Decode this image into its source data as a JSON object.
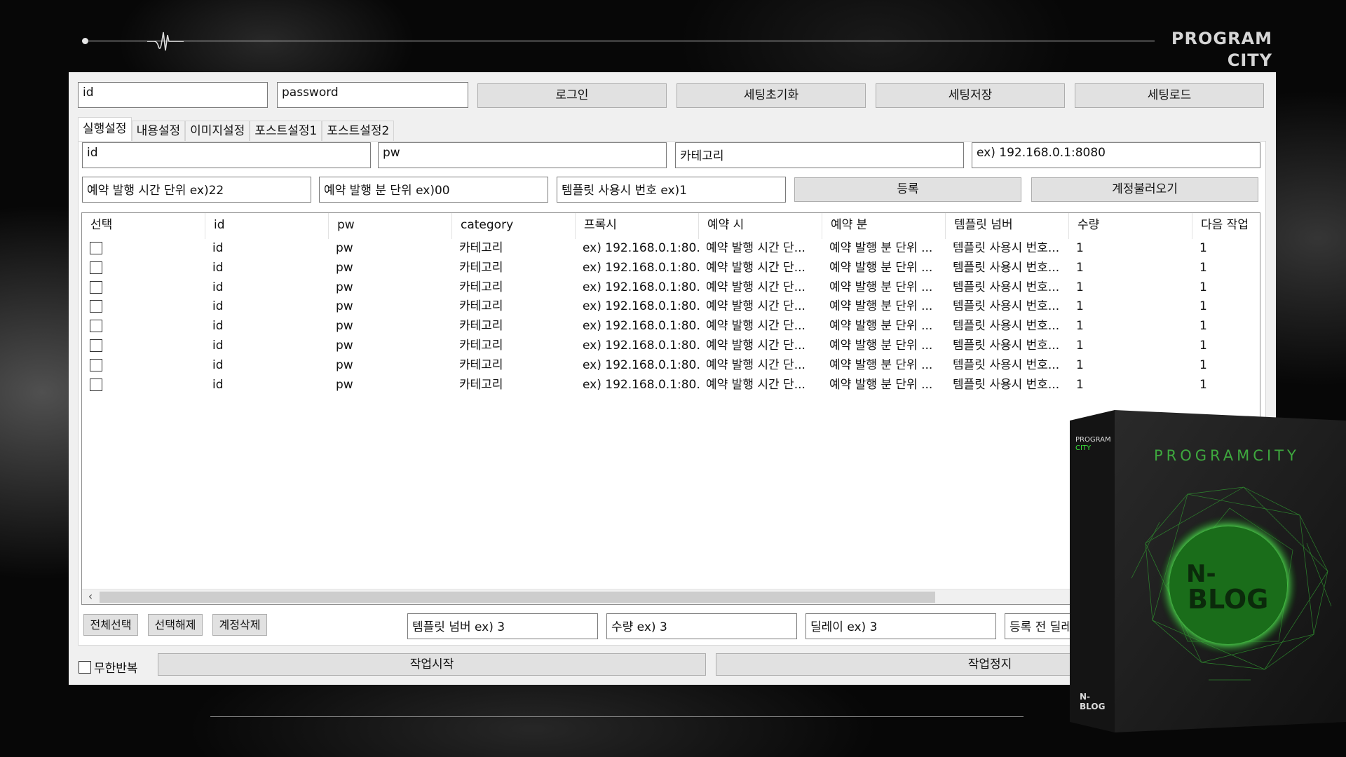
{
  "brand": {
    "line1": "PROGRAM",
    "line2": "CITY"
  },
  "login": {
    "id_placeholder": "id",
    "password_placeholder": "password",
    "login_label": "로그인",
    "reset_label": "세팅초기화",
    "save_label": "세팅저장",
    "load_label": "세팅로드"
  },
  "tabs": [
    "실행설정",
    "내용설정",
    "이미지설정",
    "포스트설정1",
    "포스트설정2"
  ],
  "form": {
    "id": "id",
    "pw": "pw",
    "category": "카테고리",
    "proxy": "ex) 192.168.0.1:8080",
    "hour": "예약 발행 시간 단위 ex)22",
    "minute": "예약 발행 분 단위 ex)00",
    "template": "템플릿 사용시 번호 ex)1",
    "register_label": "등록",
    "load_accounts_label": "계정불러오기"
  },
  "grid": {
    "headers": [
      "선택",
      "id",
      "pw",
      "category",
      "프록시",
      "예약 시",
      "예약 분",
      "템플릿 넘버",
      "수량",
      "다음 작업 "
    ],
    "rows": [
      [
        "id",
        "pw",
        "카테고리",
        "ex) 192.168.0.1:80...",
        "예약 발행 시간 단...",
        "예약 발행 분 단위 ...",
        "템플릿 사용시 번호...",
        "1",
        "1"
      ],
      [
        "id",
        "pw",
        "카테고리",
        "ex) 192.168.0.1:80...",
        "예약 발행 시간 단...",
        "예약 발행 분 단위 ...",
        "템플릿 사용시 번호...",
        "1",
        "1"
      ],
      [
        "id",
        "pw",
        "카테고리",
        "ex) 192.168.0.1:80...",
        "예약 발행 시간 단...",
        "예약 발행 분 단위 ...",
        "템플릿 사용시 번호...",
        "1",
        "1"
      ],
      [
        "id",
        "pw",
        "카테고리",
        "ex) 192.168.0.1:80...",
        "예약 발행 시간 단...",
        "예약 발행 분 단위 ...",
        "템플릿 사용시 번호...",
        "1",
        "1"
      ],
      [
        "id",
        "pw",
        "카테고리",
        "ex) 192.168.0.1:80...",
        "예약 발행 시간 단...",
        "예약 발행 분 단위 ...",
        "템플릿 사용시 번호...",
        "1",
        "1"
      ],
      [
        "id",
        "pw",
        "카테고리",
        "ex) 192.168.0.1:80...",
        "예약 발행 시간 단...",
        "예약 발행 분 단위 ...",
        "템플릿 사용시 번호...",
        "1",
        "1"
      ],
      [
        "id",
        "pw",
        "카테고리",
        "ex) 192.168.0.1:80...",
        "예약 발행 시간 단...",
        "예약 발행 분 단위 ...",
        "템플릿 사용시 번호...",
        "1",
        "1"
      ],
      [
        "id",
        "pw",
        "카테고리",
        "ex) 192.168.0.1:80...",
        "예약 발행 시간 단...",
        "예약 발행 분 단위 ...",
        "템플릿 사용시 번호...",
        "1",
        "1"
      ]
    ]
  },
  "actions": {
    "select_all": "전체선택",
    "deselect": "선택해제",
    "delete_account": "계정삭제",
    "template_number": "템플릿 넘버 ex) 3",
    "quantity": "수량 ex) 3",
    "delay": "딜레이 ex) 3",
    "pre_register_delay": "등록 전 딜레"
  },
  "run": {
    "infinite_loop": "무한반복",
    "start": "작업시작",
    "stop": "작업정지"
  },
  "product": {
    "corner_line1": "PROGRAM",
    "corner_line2": "CITY",
    "title": "PROGRAMCITY",
    "logo_line1": "N-",
    "logo_line2": "BLOG",
    "side_line1": "N-",
    "side_line2": "BLOG"
  },
  "colors": {
    "accent_green": "#39e03a",
    "bg": "#070707",
    "window": "#f0f0f0"
  }
}
